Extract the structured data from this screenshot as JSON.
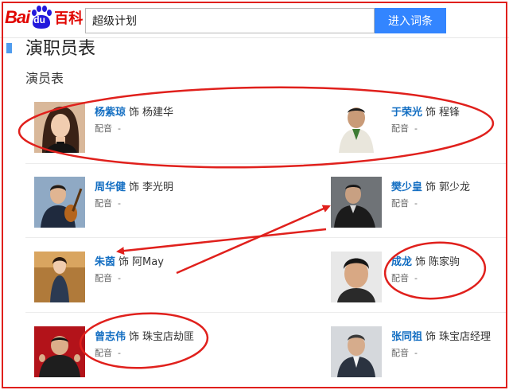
{
  "header": {
    "logo": {
      "text_bai": "Bai",
      "text_du": "du",
      "text_baike": "百科"
    },
    "search": {
      "value": "超级计划"
    },
    "search_button": "进入词条"
  },
  "section": {
    "title": "演职员表",
    "subtitle": "演员表"
  },
  "cast": [
    {
      "actor": "杨紫琼",
      "sep": "饰",
      "role": "杨建华",
      "dub_label": "配音",
      "dub_value": "-"
    },
    {
      "actor": "于荣光",
      "sep": "饰",
      "role": "程锋",
      "dub_label": "配音",
      "dub_value": "-"
    },
    {
      "actor": "周华健",
      "sep": "饰",
      "role": "李光明",
      "dub_label": "配音",
      "dub_value": "-"
    },
    {
      "actor": "樊少皇",
      "sep": "饰",
      "role": "郭少龙",
      "dub_label": "配音",
      "dub_value": "-"
    },
    {
      "actor": "朱茵",
      "sep": "饰",
      "role": "阿May",
      "dub_label": "配音",
      "dub_value": "-"
    },
    {
      "actor": "成龙",
      "sep": "饰",
      "role": "陈家驹",
      "dub_label": "配音",
      "dub_value": "-"
    },
    {
      "actor": "曾志伟",
      "sep": "饰",
      "role": "珠宝店劫匪",
      "dub_label": "配音",
      "dub_value": "-"
    },
    {
      "actor": "张同祖",
      "sep": "饰",
      "role": "珠宝店经理",
      "dub_label": "配音",
      "dub_value": "-"
    }
  ],
  "colors": {
    "link_blue": "#136ec2",
    "button_blue": "#3385ff",
    "annotation_red": "#e0201c",
    "logo_red": "#e10601"
  },
  "icons": {
    "logo": "baidu-paw-logo",
    "section_marker": "section-marker-icon"
  }
}
